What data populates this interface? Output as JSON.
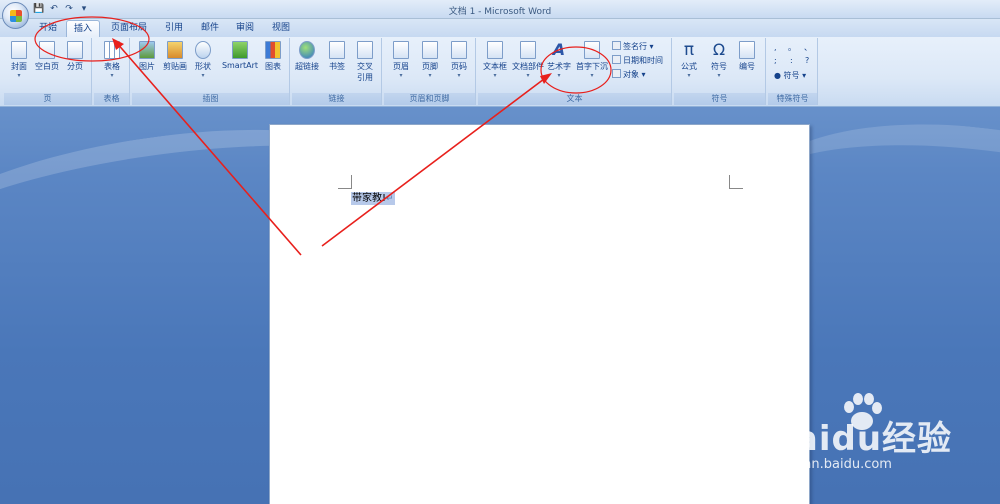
{
  "window": {
    "title": "文档 1 - Microsoft Word"
  },
  "qat": {
    "save": "💾",
    "undo": "↶",
    "redo": "↷",
    "customize": "▾"
  },
  "tabs": [
    {
      "label": "开始"
    },
    {
      "label": "插入",
      "active": true
    },
    {
      "label": "页面布局"
    },
    {
      "label": "引用"
    },
    {
      "label": "邮件"
    },
    {
      "label": "审阅"
    },
    {
      "label": "视图"
    }
  ],
  "ribbon": {
    "groups": {
      "page": "页",
      "table": "表格",
      "illustrations": "插图",
      "links": "链接",
      "header_footer": "页眉和页脚",
      "text": "文本",
      "symbols": "符号",
      "special_symbols": "特殊符号"
    },
    "buttons": {
      "cover": "封面",
      "blank_page": "空白页",
      "page_break": "分页",
      "table": "表格",
      "picture": "图片",
      "clip_art": "剪贴画",
      "shapes": "形状",
      "smartart": "SmartArt",
      "chart": "图表",
      "hyperlink": "超链接",
      "bookmark": "书签",
      "cross_ref_1": "交叉",
      "cross_ref_2": "引用",
      "header": "页眉",
      "footer": "页脚",
      "page_number": "页码",
      "text_box": "文本框",
      "quick_parts": "文档部件",
      "wordart": "艺术字",
      "drop_cap": "首字下沉",
      "signature_line": "签名行",
      "date_time": "日期和时间",
      "object": "对象",
      "equation": "公式",
      "symbol": "符号",
      "numbering": "编号",
      "special_symbol": "符号"
    },
    "special_chars": [
      ",",
      "。",
      "、",
      ";",
      ":",
      "?"
    ]
  },
  "document": {
    "selected_text": "带家教!",
    "para_mark": "↵"
  },
  "watermark": {
    "main": "Baidu经验",
    "sub": "jingyan.baidu.com"
  },
  "annotation_color": "#e8201c"
}
